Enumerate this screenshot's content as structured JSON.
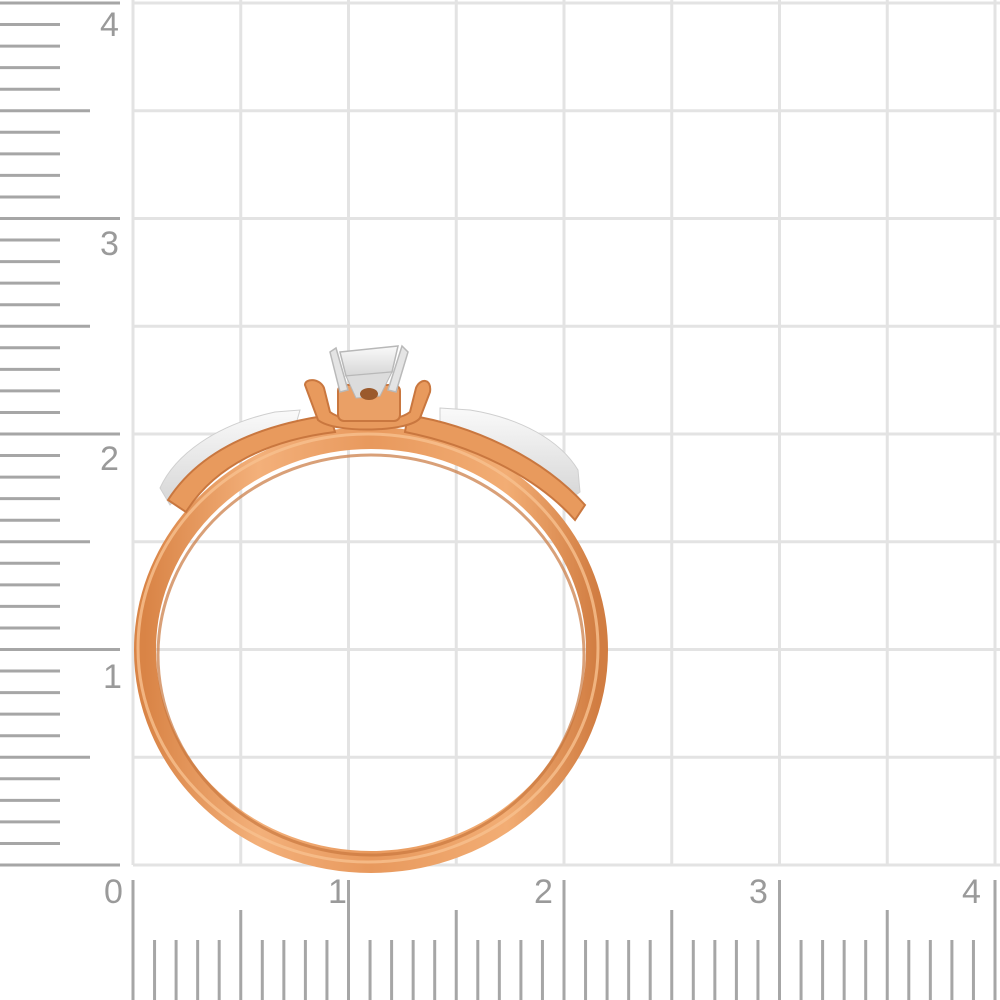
{
  "rulers": {
    "x_labels": [
      "0",
      "1",
      "2",
      "3",
      "4"
    ],
    "y_labels": [
      "1",
      "2",
      "3",
      "4"
    ]
  },
  "colors": {
    "background": "#ffffff",
    "grid": "#e3e3e3",
    "ruler": "#a6a6a6",
    "label": "#9a9a9a",
    "gold": "#e7995c",
    "gold_dark": "#c9773f",
    "gold_light": "#f6bd8a",
    "white_gold": "#ececec",
    "gem": "#f4f4f4"
  },
  "image": {
    "subject": "ring-icon"
  }
}
